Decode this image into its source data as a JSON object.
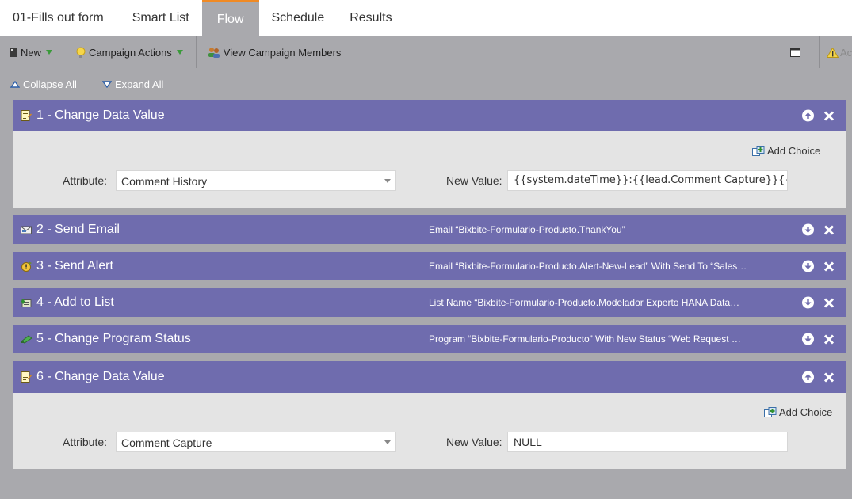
{
  "tabs": [
    {
      "label": "01-Fills out form",
      "active": false
    },
    {
      "label": "Smart List",
      "active": false
    },
    {
      "label": "Flow",
      "active": true
    },
    {
      "label": "Schedule",
      "active": false
    },
    {
      "label": "Results",
      "active": false
    }
  ],
  "toolbar": {
    "new_label": "New",
    "campaign_actions_label": "Campaign Actions",
    "view_members_label": "View Campaign Members",
    "activity_label": "Activity"
  },
  "expand": {
    "collapse_all": "Collapse All",
    "expand_all": "Expand All"
  },
  "steps": [
    {
      "title": "1 - Change Data Value",
      "summary": "",
      "expanded": true,
      "add_choice": "Add Choice",
      "attribute_label": "Attribute:",
      "attribute_value": "Comment History",
      "new_value_label": "New Value:",
      "new_value": "{{system.dateTime}}:{{lead.Comment Capture}}{{my."
    },
    {
      "title": "2 - Send Email",
      "summary": "Email “Bixbite-Formulario-Producto.ThankYou”",
      "expanded": false
    },
    {
      "title": "3 - Send Alert",
      "summary": "Email “Bixbite-Formulario-Producto.Alert-New-Lead” With Send To “Sales…",
      "expanded": false
    },
    {
      "title": "4 - Add to List",
      "summary": "List Name “Bixbite-Formulario-Producto.Modelador Experto HANA Data…",
      "expanded": false
    },
    {
      "title": "5 - Change Program Status",
      "summary": "Program “Bixbite-Formulario-Producto” With New Status “Web Request …",
      "expanded": false
    },
    {
      "title": "6 - Change Data Value",
      "summary": "",
      "expanded": true,
      "add_choice": "Add Choice",
      "attribute_label": "Attribute:",
      "attribute_value": "Comment Capture",
      "new_value_label": "New Value:",
      "new_value": "NULL"
    }
  ],
  "colors": {
    "accent_orange": "#f08a24",
    "step_header": "#6f6cae",
    "background": "#a9a9ad",
    "step_body": "#e4e4e4"
  },
  "icons": {
    "new": "document-icon",
    "campaign_actions": "lightbulb-icon",
    "view_members": "people-icon",
    "collapse_all": "triangle-up-icon",
    "expand_all": "triangle-down-icon",
    "window": "window-icon",
    "warning": "warning-icon",
    "add_choice": "add-choice-icon"
  }
}
